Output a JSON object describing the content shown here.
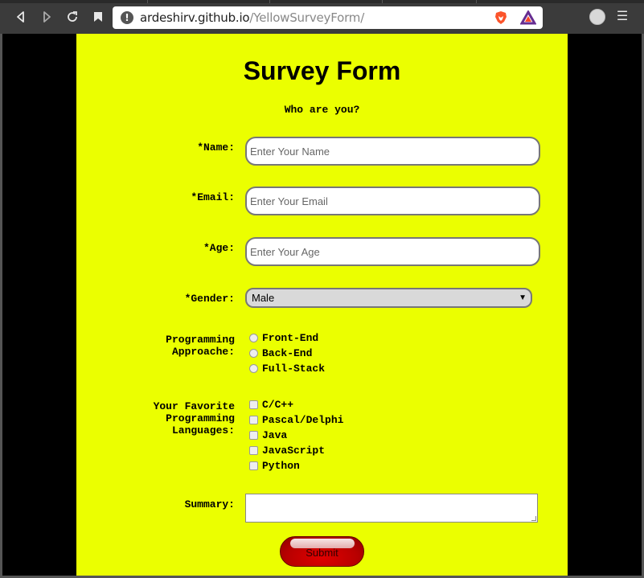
{
  "browser": {
    "url_host": "ardeshirv.github.io",
    "url_path": "/YellowSurveyForm/",
    "icons": [
      "back-icon",
      "forward-icon",
      "reload-icon",
      "bookmark-icon",
      "site-info-icon",
      "brave-shields-icon",
      "brave-rewards-icon",
      "profile-icon",
      "menu-icon"
    ]
  },
  "page": {
    "background": "#ebff00",
    "title": "Survey Form",
    "subtitle": "Who are you?",
    "name": {
      "label": "*Name:",
      "placeholder": "Enter Your Name"
    },
    "email": {
      "label": "*Email:",
      "placeholder": "Enter Your Email"
    },
    "age": {
      "label": "*Age:",
      "placeholder": "Enter Your Age"
    },
    "gender": {
      "label": "*Gender:",
      "selected": "Male"
    },
    "approach": {
      "label_line1": "Programming",
      "label_line2": "Approache:",
      "options": [
        "Front-End",
        "Back-End",
        "Full-Stack"
      ]
    },
    "languages": {
      "label_line1": "Your Favorite",
      "label_line2": "Programming",
      "label_line3": "Languages:",
      "options": [
        "C/C++",
        "Pascal/Delphi",
        "Java",
        "JavaScript",
        "Python"
      ]
    },
    "summary": {
      "label": "Summary:"
    },
    "submit": {
      "label": "Submit",
      "color": "#c00000"
    }
  }
}
